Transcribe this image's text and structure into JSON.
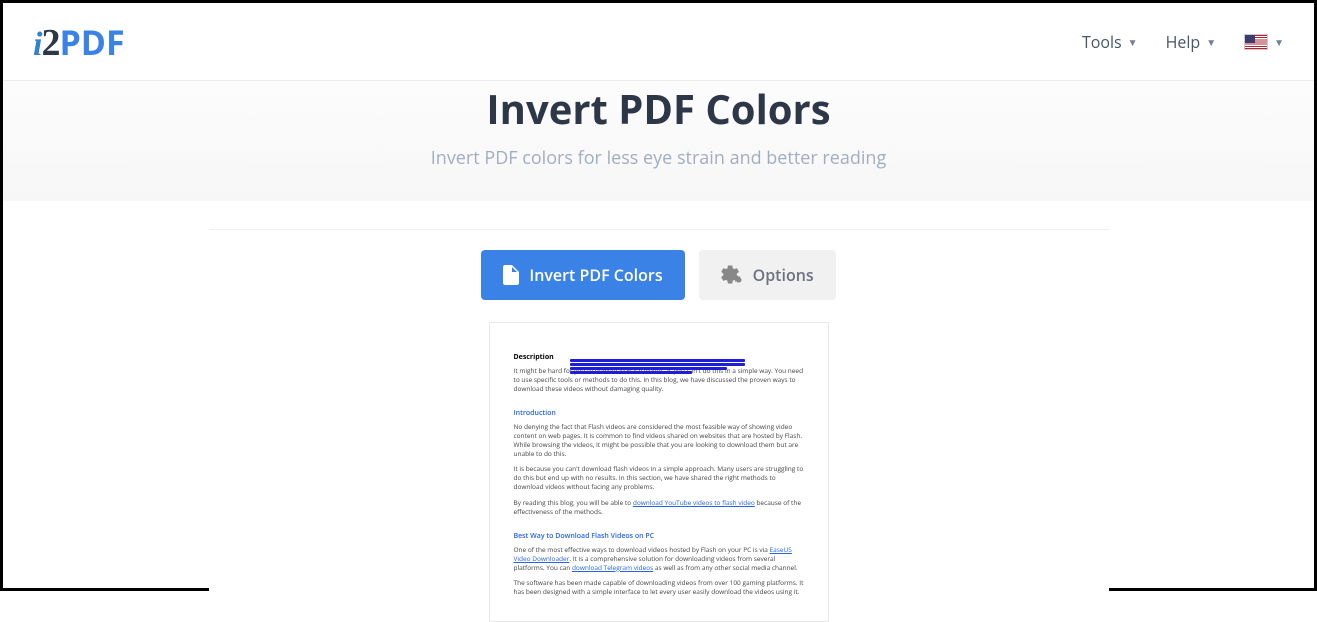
{
  "header": {
    "logo_i": "i",
    "logo_2": "2",
    "logo_pdf": "PDF",
    "nav": {
      "tools": "Tools",
      "help": "Help"
    }
  },
  "page": {
    "title": "Invert PDF Colors",
    "subtitle": "Invert PDF colors for less eye strain and better reading"
  },
  "tabs": {
    "invert": "Invert PDF Colors",
    "options": "Options"
  },
  "doc": {
    "desc_h": "Description",
    "desc_p": "It might be hard for you to download Flash videos as you can't do this in a simple way. You need to use specific tools or methods to do this. In this blog, we have discussed the proven ways to download these videos without damaging quality.",
    "intro_h": "Introduction",
    "intro_p1": "No denying the fact that Flash videos are considered the most feasible way of showing video content on web pages. It is common to find videos shared on websites that are hosted by Flash. While browsing the videos, it might be possible that you are looking to download them but are unable to do this.",
    "intro_p2": "It is because you can't download flash videos in a simple approach. Many users are struggling to do this but end up with no results. In this section, we have shared the right methods to download videos without facing any problems.",
    "intro_p3a": "By reading this blog, you will be able to ",
    "intro_link1": "download YouTube videos to flash video",
    "intro_p3b": " because of the effectiveness of the methods.",
    "best_h": "Best Way to Download Flash Videos on PC",
    "best_p1a": "One of the most effective ways to download videos hosted by Flash on your PC is via ",
    "best_link1": "EaseUS Video Downloader",
    "best_p1b": ". It is a comprehensive solution for downloading videos from several platforms. You can ",
    "best_link2": "download Telegram videos",
    "best_p1c": " as well as from any other social media channel.",
    "best_p2": "The software has been made capable of downloading videos from over 100 gaming platforms. It has been designed with a simple interface to let every user easily download the videos using it."
  }
}
